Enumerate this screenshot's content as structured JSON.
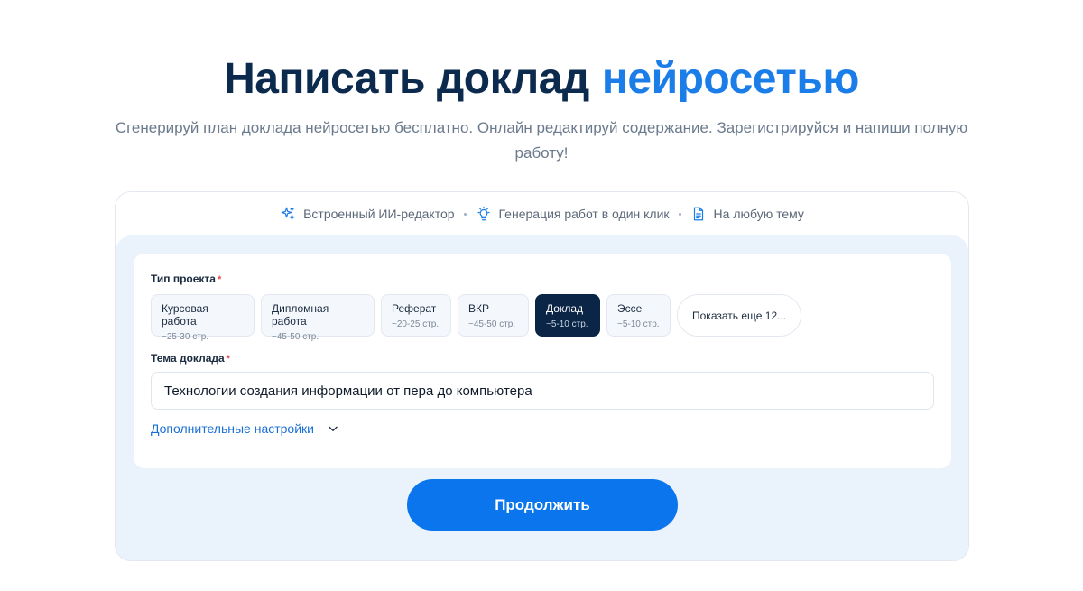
{
  "hero": {
    "title_main": "Написать доклад",
    "title_accent": "нейросетью",
    "subtitle": "Сгенерируй план доклада нейросетью бесплатно. Онлайн редактируй содержание. Зарегистрируйся и напиши полную работу!"
  },
  "features": [
    {
      "icon": "sparkles-icon",
      "label": "Встроенный ИИ-редактор"
    },
    {
      "icon": "lightbulb-icon",
      "label": "Генерация работ в один клик"
    },
    {
      "icon": "document-icon",
      "label": "На любую тему"
    }
  ],
  "form": {
    "project_type_label": "Тип проекта",
    "required_mark": "*",
    "project_types": [
      {
        "name": "Курсовая работа",
        "pages": "~25-30 стр.",
        "selected": false
      },
      {
        "name": "Дипломная работа",
        "pages": "~45-50 стр.",
        "selected": false
      },
      {
        "name": "Реферат",
        "pages": "~20-25 стр.",
        "selected": false
      },
      {
        "name": "ВКР",
        "pages": "~45-50 стр.",
        "selected": false
      },
      {
        "name": "Доклад",
        "pages": "~5-10 стр.",
        "selected": true
      },
      {
        "name": "Эссе",
        "pages": "~5-10 стр.",
        "selected": false
      }
    ],
    "show_more_label": "Показать еще 12...",
    "topic_label": "Тема доклада",
    "topic_value": "Технологии создания информации от пера до компьютера",
    "advanced_label": "Дополнительные настройки",
    "continue_label": "Продолжить"
  },
  "colors": {
    "title": "#0c2a4d",
    "accent": "#1a7de8",
    "selected_chip": "#0b2547",
    "primary_button": "#0a75ec",
    "panel_background": "#eaf2fb"
  }
}
